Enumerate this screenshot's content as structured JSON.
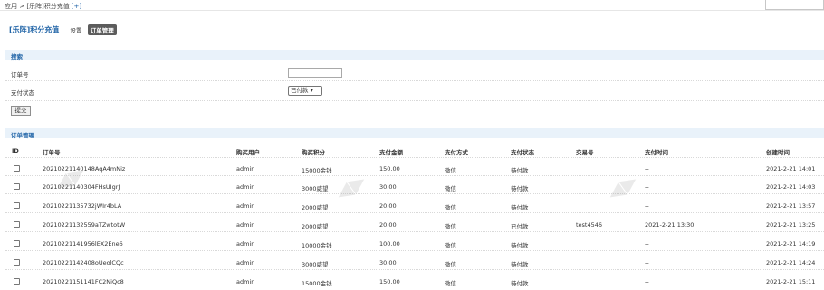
{
  "breadcrumb": {
    "text": "应用 > [乐阵]积分充值",
    "add_label": "[+]"
  },
  "header": {
    "title": "[乐阵]积分充值",
    "nav_settings": "设置",
    "nav_orders": "订单管理"
  },
  "search": {
    "section_title": "搜索",
    "order_no_label": "订单号",
    "order_no_value": "",
    "status_label": "支付状态",
    "status_selected": "已付款 ▾",
    "submit_label": "提交"
  },
  "orders": {
    "section_title": "订单管理",
    "columns": [
      "ID",
      "订单号",
      "购买用户",
      "购买积分",
      "支付金额",
      "支付方式",
      "支付状态",
      "交易号",
      "支付时间",
      "创建时间"
    ],
    "rows": [
      {
        "order_no": "20210221140148AqA4mNiz",
        "user": "admin",
        "points": "15000金钱",
        "amount": "150.00",
        "method": "微信",
        "status": "待付款",
        "trade_no": "",
        "pay_time": "--",
        "created": "2021-2-21 14:01"
      },
      {
        "order_no": "20210221140304FHsUIgrJ",
        "user": "admin",
        "points": "3000威望",
        "amount": "30.00",
        "method": "微信",
        "status": "待付款",
        "trade_no": "",
        "pay_time": "--",
        "created": "2021-2-21 14:03"
      },
      {
        "order_no": "20210221135732jWIr4bLA",
        "user": "admin",
        "points": "2000威望",
        "amount": "20.00",
        "method": "微信",
        "status": "待付款",
        "trade_no": "",
        "pay_time": "--",
        "created": "2021-2-21 13:57"
      },
      {
        "order_no": "20210221132559aTZwtotW",
        "user": "admin",
        "points": "2000威望",
        "amount": "20.00",
        "method": "微信",
        "status": "已付款",
        "trade_no": "test4546",
        "pay_time": "2021-2-21 13:30",
        "created": "2021-2-21 13:25"
      },
      {
        "order_no": "20210221141956lEX2Ene6",
        "user": "admin",
        "points": "10000金钱",
        "amount": "100.00",
        "method": "微信",
        "status": "待付款",
        "trade_no": "",
        "pay_time": "--",
        "created": "2021-2-21 14:19"
      },
      {
        "order_no": "20210221142408oUeolCQc",
        "user": "admin",
        "points": "3000威望",
        "amount": "30.00",
        "method": "微信",
        "status": "待付款",
        "trade_no": "",
        "pay_time": "--",
        "created": "2021-2-21 14:24"
      },
      {
        "order_no": "20210221151141FC2NiQc8",
        "user": "admin",
        "points": "15000金钱",
        "amount": "150.00",
        "method": "微信",
        "status": "待付款",
        "trade_no": "",
        "pay_time": "--",
        "created": "2021-2-21 15:11"
      }
    ]
  }
}
